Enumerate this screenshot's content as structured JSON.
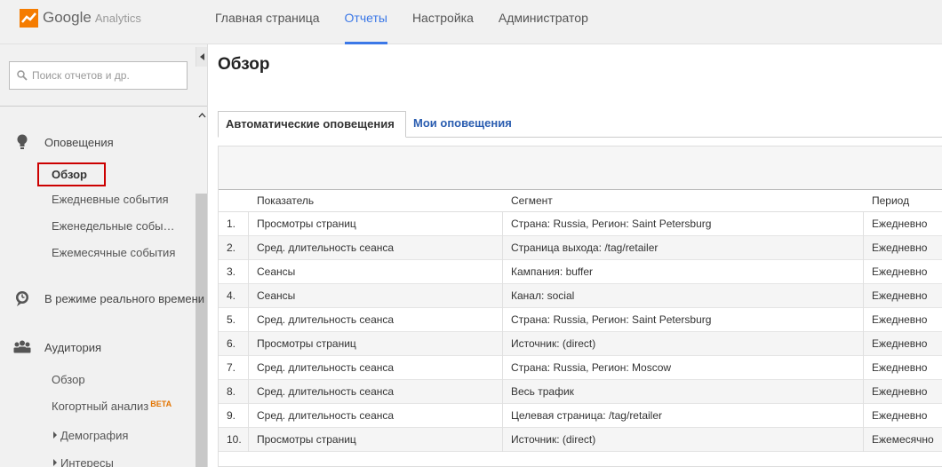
{
  "app": {
    "brand": "Google",
    "product": "Analytics"
  },
  "topnav": {
    "items": [
      {
        "label": "Главная страница"
      },
      {
        "label": "Отчеты"
      },
      {
        "label": "Настройка"
      },
      {
        "label": "Администратор"
      }
    ],
    "active_index": 1
  },
  "sidebar": {
    "search_placeholder": "Поиск отчетов и др.",
    "sections": {
      "alerts": {
        "label": "Оповещения",
        "items": [
          "Обзор",
          "Ежедневные события",
          "Еженедельные собы…",
          "Ежемесячные события"
        ],
        "selected": "Обзор"
      },
      "realtime": {
        "label": "В режиме реального времени"
      },
      "audience": {
        "label": "Аудитория",
        "items": [
          "Обзор",
          "Когортный анализ",
          "Демография",
          "Интересы"
        ],
        "beta_badge": "BETA"
      }
    }
  },
  "main": {
    "title": "Обзор",
    "tabs": [
      "Автоматические оповещения",
      "Мои оповещения"
    ],
    "active_tab": 0,
    "table": {
      "headers": {
        "metric": "Показатель",
        "segment": "Сегмент",
        "period": "Период"
      },
      "rows": [
        {
          "num": "1.",
          "metric": "Просмотры страниц",
          "segment": "Страна: Russia, Регион: Saint Petersburg",
          "period": "Ежедневно"
        },
        {
          "num": "2.",
          "metric": "Сред. длительность сеанса",
          "segment": "Страница выхода: /tag/retailer",
          "period": "Ежедневно"
        },
        {
          "num": "3.",
          "metric": "Сеансы",
          "segment": "Кампания: buffer",
          "period": "Ежедневно"
        },
        {
          "num": "4.",
          "metric": "Сеансы",
          "segment": "Канал: social",
          "period": "Ежедневно"
        },
        {
          "num": "5.",
          "metric": "Сред. длительность сеанса",
          "segment": "Страна: Russia, Регион: Saint Petersburg",
          "period": "Ежедневно"
        },
        {
          "num": "6.",
          "metric": "Просмотры страниц",
          "segment": "Источник: (direct)",
          "period": "Ежедневно"
        },
        {
          "num": "7.",
          "metric": "Сред. длительность сеанса",
          "segment": "Страна: Russia, Регион: Moscow",
          "period": "Ежедневно"
        },
        {
          "num": "8.",
          "metric": "Сред. длительность сеанса",
          "segment": "Весь трафик",
          "period": "Ежедневно"
        },
        {
          "num": "9.",
          "metric": "Сред. длительность сеанса",
          "segment": "Целевая страница: /tag/retailer",
          "period": "Ежедневно"
        },
        {
          "num": "10.",
          "metric": "Просмотры страниц",
          "segment": "Источник: (direct)",
          "period": "Ежемесячно"
        }
      ]
    }
  },
  "colors": {
    "accent": "#3b78e7",
    "link": "#2a5db0",
    "selection_border": "#cc0000",
    "logo_orange": "#f57c00",
    "beta": "#e37400"
  }
}
